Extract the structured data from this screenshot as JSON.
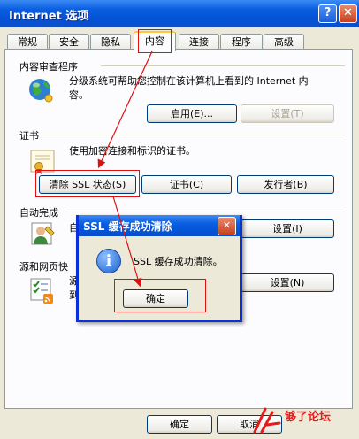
{
  "window": {
    "title": "Internet 选项",
    "help_glyph": "?",
    "close_glyph": "✕"
  },
  "tabs": [
    {
      "label": "常规",
      "active": false
    },
    {
      "label": "安全",
      "active": false
    },
    {
      "label": "隐私",
      "active": false
    },
    {
      "label": "内容",
      "active": true
    },
    {
      "label": "连接",
      "active": false
    },
    {
      "label": "程序",
      "active": false
    },
    {
      "label": "高级",
      "active": false
    }
  ],
  "content_advisor": {
    "title": "内容审查程序",
    "description_line1": "分级系统可帮助您控制在该计算机上看到的 Internet 内",
    "description_line2": "容。",
    "enable_button": "启用(E)...",
    "settings_button": "设置(T)",
    "icon": "globe-icon"
  },
  "certificates": {
    "title": "证书",
    "description": "使用加密连接和标识的证书。",
    "clear_ssl_button": "清除 SSL 状态(S)",
    "certificates_button": "证书(C)",
    "publishers_button": "发行者(B)",
    "icon": "certificate-icon"
  },
  "autocomplete": {
    "title": "自动完成",
    "description_fragment": "自",
    "settings_button": "设置(I)",
    "icon": "user-icon"
  },
  "feeds": {
    "title": "源和网页快",
    "description_fragment1": "源",
    "description_fragment2": "到",
    "settings_button": "设置(N)",
    "icon": "feeds-icon"
  },
  "footer": {
    "ok_button": "确定",
    "cancel_button": "取消"
  },
  "dialog": {
    "title": "SSL 缓存成功清除",
    "message": "SSL 缓存成功清除。",
    "ok_button": "确定",
    "info_glyph": "i",
    "close_glyph": "✕"
  },
  "watermark": {
    "text": "够了论坛"
  },
  "colors": {
    "titlebar_blue": "#0453d6",
    "annotation_red": "#e01010"
  }
}
